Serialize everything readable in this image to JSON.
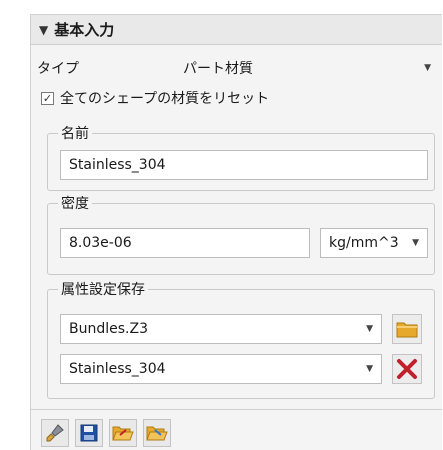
{
  "section": {
    "title": "基本入力"
  },
  "type_row": {
    "label": "タイプ",
    "value": "パート材質"
  },
  "reset_all": {
    "label": "全てのシェープの材質をリセット",
    "checked": true
  },
  "name_group": {
    "title": "名前",
    "value": "Stainless_304"
  },
  "density_group": {
    "title": "密度",
    "value": "8.03e-06",
    "unit": "kg/mm^3"
  },
  "attr_group": {
    "title": "属性設定保存",
    "library": "Bundles.Z3",
    "material": "Stainless_304"
  },
  "icons": {
    "folder": "folder-icon",
    "delete": "delete-x-icon",
    "toolbar": [
      "brush-icon",
      "save-icon",
      "folder-open-icon",
      "folder-export-icon"
    ]
  },
  "colors": {
    "folder": "#e6a92c",
    "delete": "#c0202a",
    "save": "#1f4fa3"
  }
}
